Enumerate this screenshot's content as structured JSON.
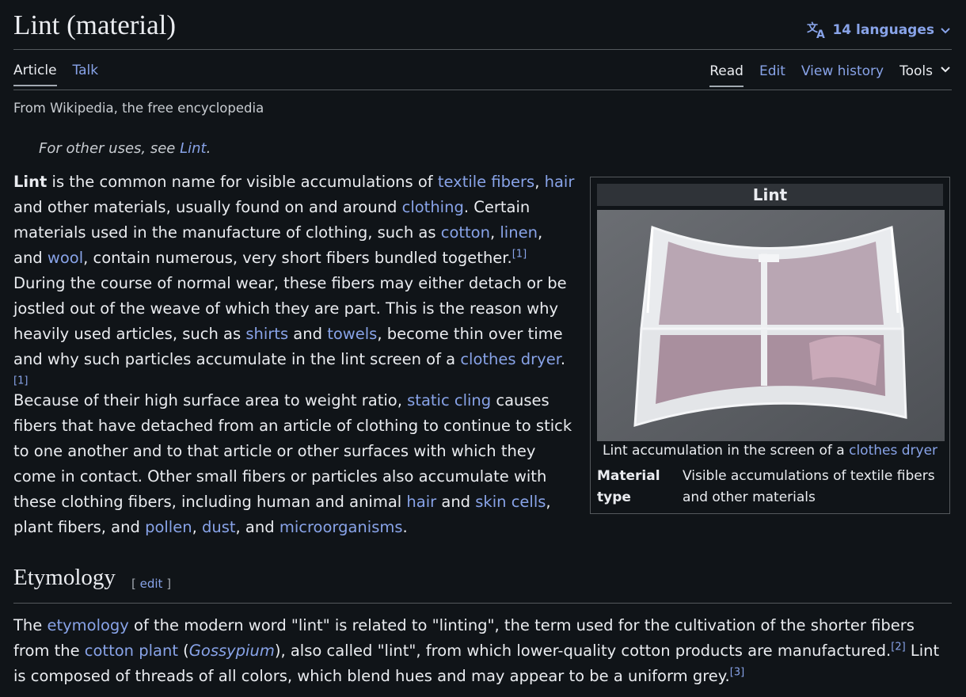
{
  "header": {
    "title": "Lint (material)",
    "languages_label": "14 languages"
  },
  "tabs": {
    "left": [
      "Article",
      "Talk"
    ],
    "right": [
      "Read",
      "Edit",
      "View history"
    ],
    "tools_label": "Tools"
  },
  "tagline": "From Wikipedia, the free encyclopedia",
  "hatnote": {
    "prefix": "For other uses, see ",
    "link": "Lint",
    "suffix": "."
  },
  "paragraphs": {
    "p1": [
      {
        "b": "Lint"
      },
      {
        "t": " is the common name for visible accumulations of "
      },
      {
        "l": "textile fibers"
      },
      {
        "t": ", "
      },
      {
        "l": "hair"
      },
      {
        "t": " and other materials, usually found on and around "
      },
      {
        "l": "clothing"
      },
      {
        "t": ". Certain materials used in the manufacture of clothing, such as "
      },
      {
        "l": "cotton"
      },
      {
        "t": ", "
      },
      {
        "l": "linen"
      },
      {
        "t": ", and "
      },
      {
        "l": "wool"
      },
      {
        "t": ", contain numerous, very short fibers bundled together."
      },
      {
        "s": "[1]"
      },
      {
        "t": " During the course of normal wear, these fibers may either detach or be jostled out of the weave of which they are part. This is the reason why heavily used articles, such as "
      },
      {
        "l": "shirts"
      },
      {
        "t": " and "
      },
      {
        "l": "towels"
      },
      {
        "t": ", become thin over time and why such particles accumulate in the lint screen of a "
      },
      {
        "l": "clothes dryer"
      },
      {
        "t": "."
      },
      {
        "s": "[1]"
      }
    ],
    "p2": [
      {
        "t": "Because of their high surface area to weight ratio, "
      },
      {
        "l": "static cling"
      },
      {
        "t": " causes fibers that have detached from an article of clothing to continue to stick to one another and to that article or other surfaces with which they come in contact. Other small fibers or particles also accumulate with these clothing fibers, including human and animal "
      },
      {
        "l": "hair"
      },
      {
        "t": " and "
      },
      {
        "l": "skin cells"
      },
      {
        "t": ", plant fibers, and "
      },
      {
        "l": "pollen"
      },
      {
        "t": ", "
      },
      {
        "l": "dust"
      },
      {
        "t": ", and "
      },
      {
        "l": "microorganisms"
      },
      {
        "t": "."
      }
    ],
    "p3": [
      {
        "t": "The "
      },
      {
        "l": "etymology"
      },
      {
        "t": " of the modern word \"lint\" is related to \"linting\", the term used for the cultivation of the shorter fibers from the "
      },
      {
        "l": "cotton plant"
      },
      {
        "t": " ("
      },
      {
        "li": "Gossypium"
      },
      {
        "t": "), also called \"lint\", from which lower-quality cotton products are manufactured."
      },
      {
        "s": "[2]"
      },
      {
        "t": " Lint is composed of threads of all colors, which blend hues and may appear to be a uniform grey."
      },
      {
        "s": "[3]"
      }
    ]
  },
  "infobox": {
    "title": "Lint",
    "caption_prefix": "Lint accumulation in the screen of a ",
    "caption_link": "clothes dryer",
    "row_label": "Material type",
    "row_value": "Visible accumulations of textile fibers and other materials"
  },
  "section": {
    "heading": "Etymology",
    "edit_open": "[ ",
    "edit_label": "edit",
    "edit_close": " ]"
  },
  "colors": {
    "link": "#88a3e8",
    "background": "#101418",
    "text": "#eaecf0"
  }
}
